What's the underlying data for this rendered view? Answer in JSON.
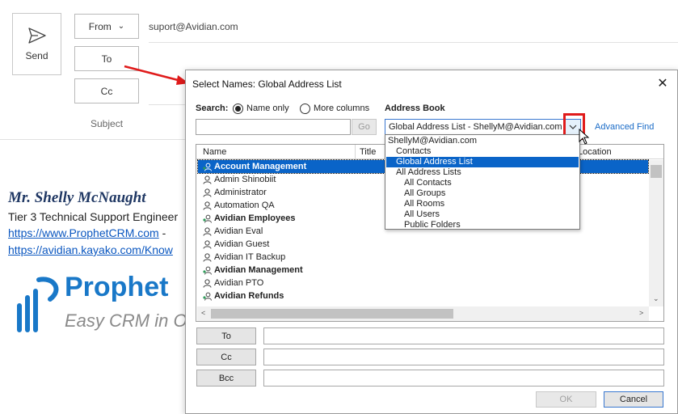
{
  "compose": {
    "send_label": "Send",
    "from_label": "From",
    "from_value": "suport@Avidian.com",
    "to_label": "To",
    "cc_label": "Cc",
    "subject_label": "Subject"
  },
  "signature": {
    "name": "Mr. Shelly McNaught",
    "title": "Tier 3 Technical Support Engineer",
    "link1": "https://www.ProphetCRM.com",
    "link1_suffix": " -",
    "link2": "https://avidian.kayako.com/Know",
    "logo_text": "Prophet",
    "logo_tagline": "Easy CRM in O"
  },
  "dialog": {
    "title": "Select Names: Global Address List",
    "search_label": "Search:",
    "radio_name_only": "Name only",
    "radio_more_columns": "More columns",
    "address_book_label": "Address Book",
    "search_value": "",
    "go_label": "Go",
    "address_book_value": "Global Address List - ShellyM@Avidian.com",
    "advanced_find": "Advanced Find",
    "columns": {
      "name": "Name",
      "title": "Title",
      "location": "Location"
    },
    "rows": [
      {
        "name": "Account Management",
        "type": "group",
        "selected": true
      },
      {
        "name": "Admin Shinobiit",
        "type": "user"
      },
      {
        "name": "Administrator",
        "type": "user"
      },
      {
        "name": "Automation QA",
        "type": "user"
      },
      {
        "name": "Avidian Employees",
        "type": "group"
      },
      {
        "name": "Avidian Eval",
        "type": "user"
      },
      {
        "name": "Avidian Guest",
        "type": "user"
      },
      {
        "name": "Avidian IT Backup",
        "type": "user"
      },
      {
        "name": "Avidian Management",
        "type": "group"
      },
      {
        "name": "Avidian PTO",
        "type": "user"
      },
      {
        "name": "Avidian Refunds",
        "type": "group"
      }
    ],
    "to_button": "To",
    "cc_button": "Cc",
    "bcc_button": "Bcc",
    "ok_label": "OK",
    "cancel_label": "Cancel"
  },
  "dropdown": {
    "items": [
      {
        "label": "ShellyM@Avidian.com",
        "indent": 0,
        "selected": false
      },
      {
        "label": "Contacts",
        "indent": 1,
        "selected": false
      },
      {
        "label": "Global Address List",
        "indent": 1,
        "selected": true
      },
      {
        "label": "All Address Lists",
        "indent": 1,
        "selected": false
      },
      {
        "label": "All Contacts",
        "indent": 2,
        "selected": false
      },
      {
        "label": "All Groups",
        "indent": 2,
        "selected": false
      },
      {
        "label": "All Rooms",
        "indent": 2,
        "selected": false
      },
      {
        "label": "All Users",
        "indent": 2,
        "selected": false
      },
      {
        "label": "Public Folders",
        "indent": 2,
        "selected": false
      }
    ]
  },
  "colors": {
    "selection": "#0a64c8",
    "highlight_red": "#e01b1b",
    "link": "#0b57c0",
    "logo_blue": "#1978c8"
  }
}
